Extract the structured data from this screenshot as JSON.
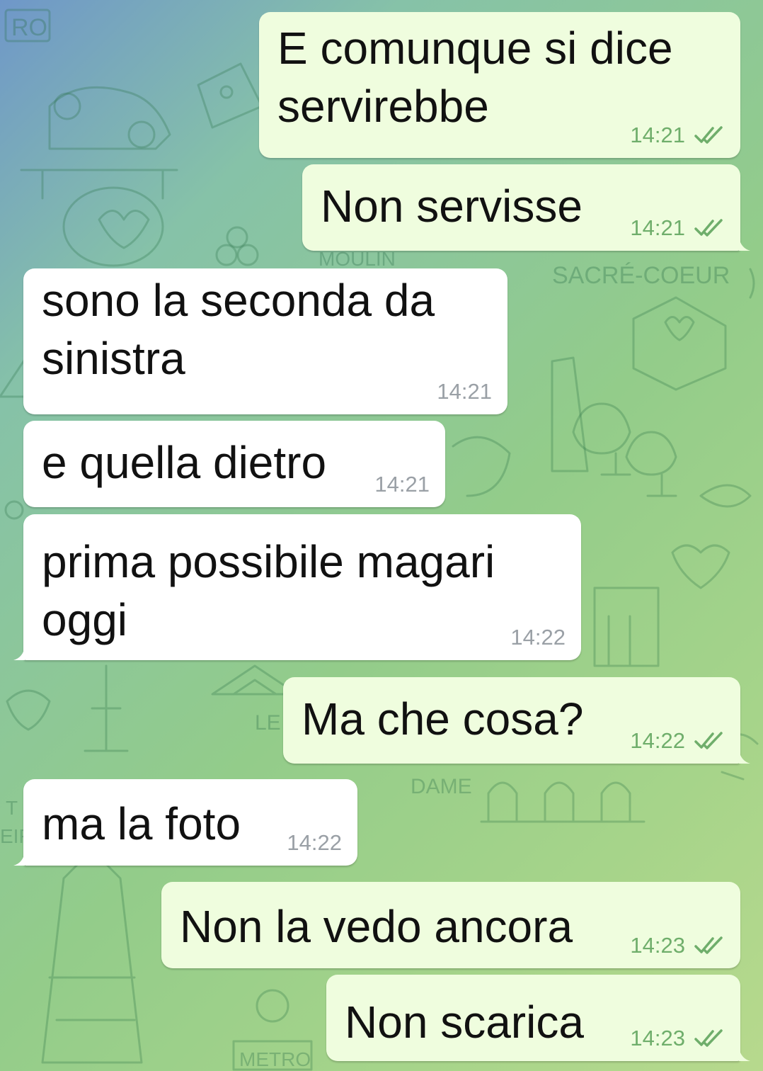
{
  "messages": [
    {
      "direction": "out",
      "text_lines": [
        "E comunque si dice",
        "servirebbe"
      ],
      "time": "14:21",
      "read": true
    },
    {
      "direction": "out",
      "text_lines": [
        "Non servisse"
      ],
      "time": "14:21",
      "read": true
    },
    {
      "direction": "in",
      "text_lines": [
        "sono la seconda da",
        "sinistra"
      ],
      "time": "14:21"
    },
    {
      "direction": "in",
      "text_lines": [
        "e quella dietro"
      ],
      "time": "14:21"
    },
    {
      "direction": "in",
      "text_lines": [
        "prima possibile magari",
        "oggi"
      ],
      "time": "14:22"
    },
    {
      "direction": "out",
      "text_lines": [
        "Ma che cosa?"
      ],
      "time": "14:22",
      "read": true
    },
    {
      "direction": "in",
      "text_lines": [
        "ma la foto"
      ],
      "time": "14:22"
    },
    {
      "direction": "out",
      "text_lines": [
        "Non la vedo ancora"
      ],
      "time": "14:23",
      "read": true
    },
    {
      "direction": "out",
      "text_lines": [
        "Non scarica"
      ],
      "time": "14:23",
      "read": true
    }
  ],
  "wallpaper_labels": [
    "RO",
    "MOULIN",
    "SACRÉ-COEUR",
    "LE",
    "DAME",
    "METRO",
    "EIF",
    "T"
  ],
  "colors": {
    "outgoing_bubble": "#effdde",
    "incoming_bubble": "#ffffff",
    "read_check": "#6fae6b",
    "incoming_time": "#9aa0a6"
  },
  "icons": {
    "read_receipt": "double-check-icon"
  }
}
